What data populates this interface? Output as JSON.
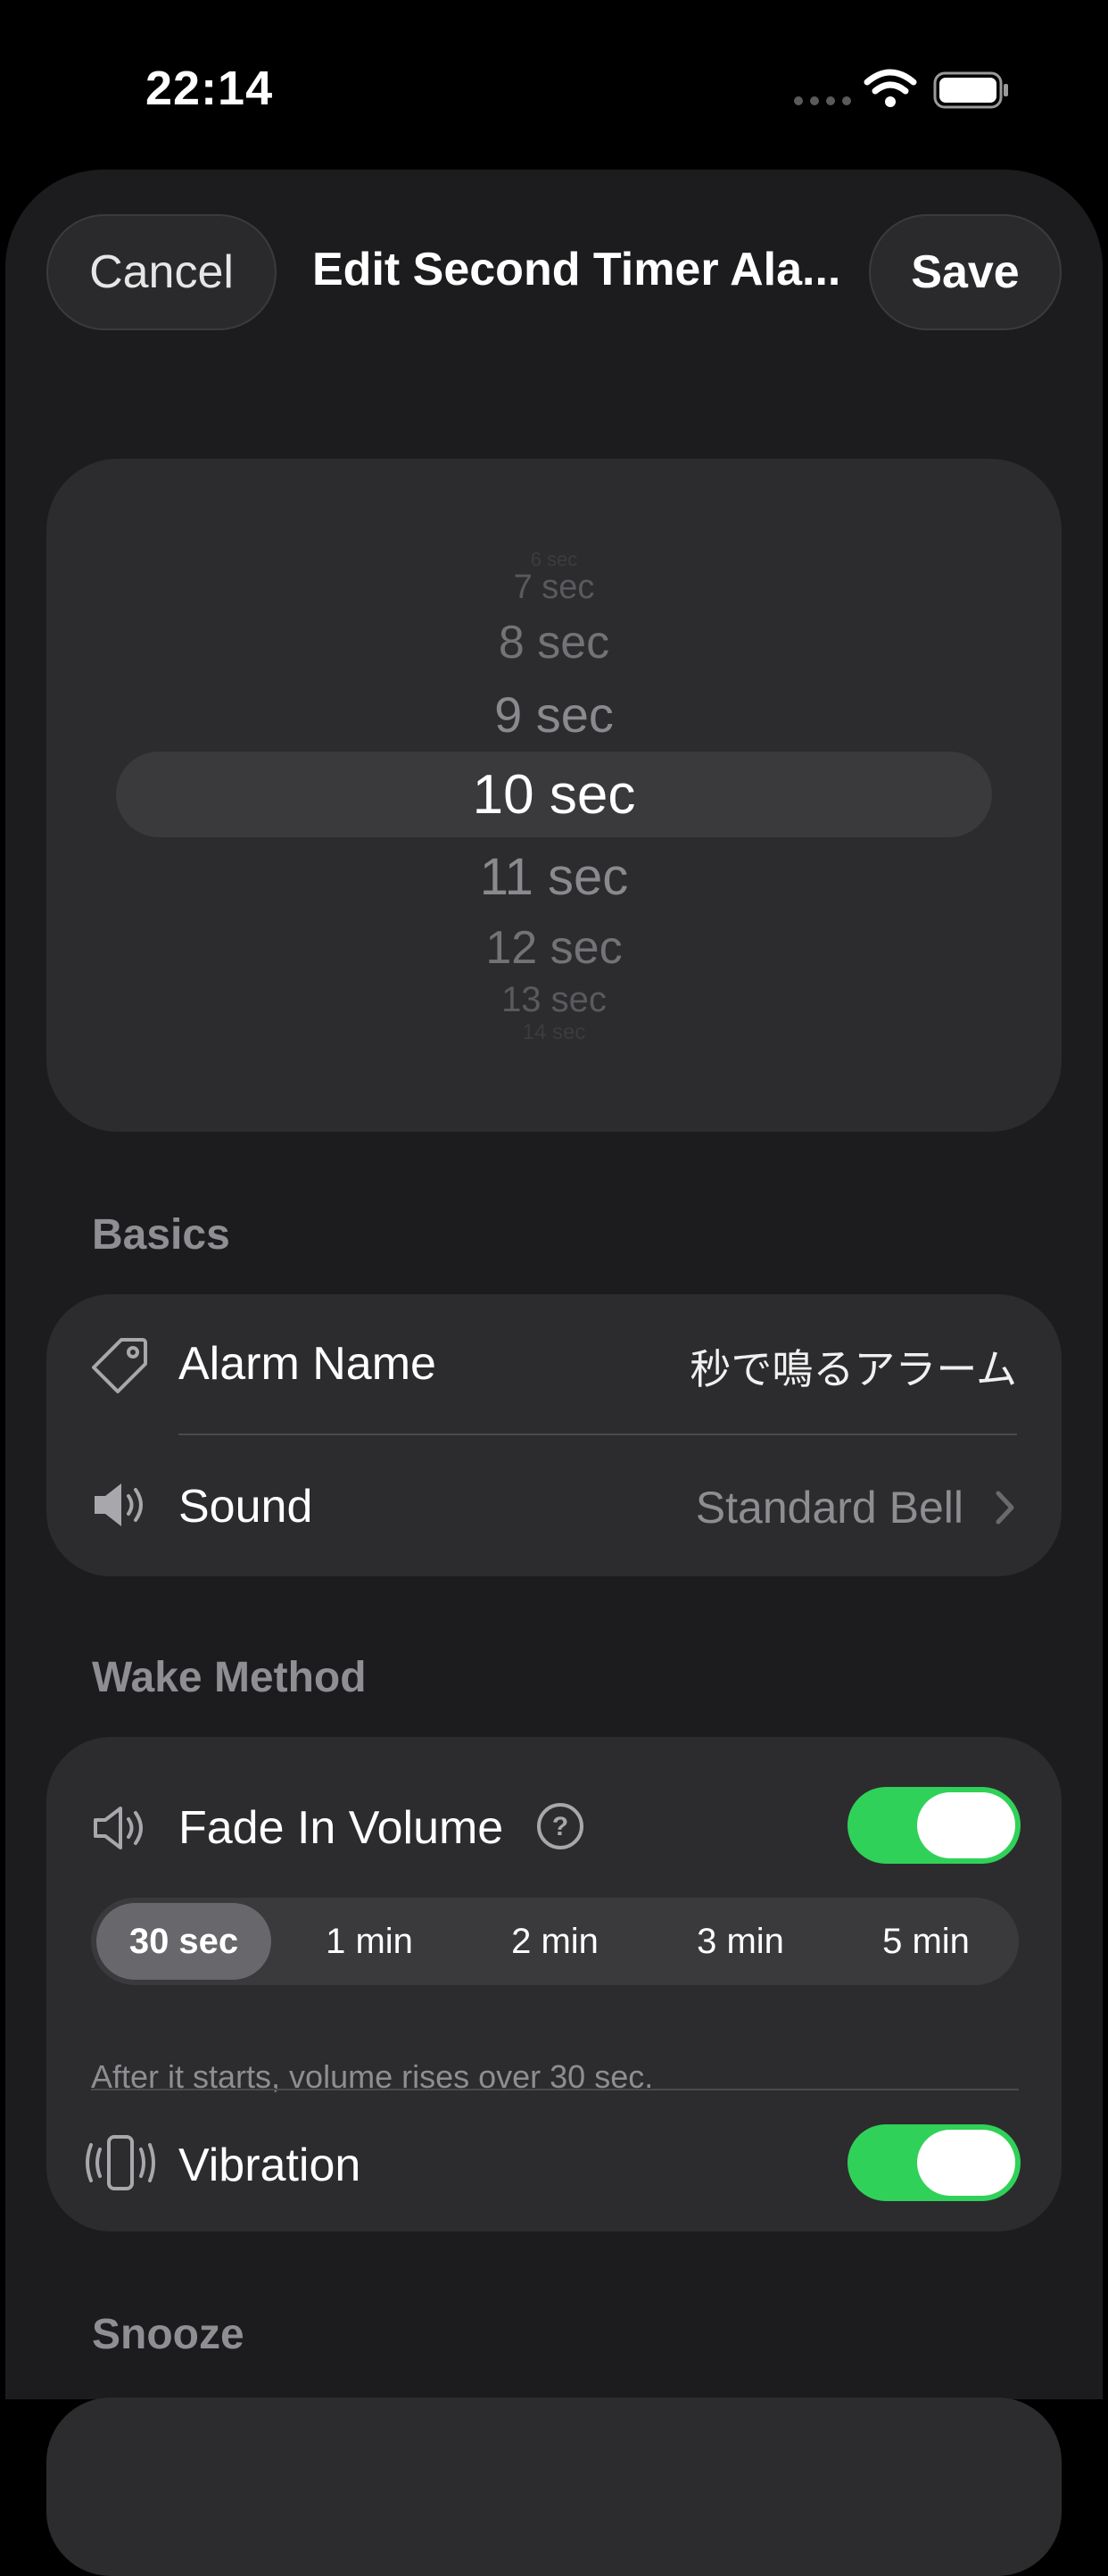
{
  "status": {
    "time": "22:14"
  },
  "nav": {
    "cancel": "Cancel",
    "title": "Edit Second Timer Ala...",
    "save": "Save"
  },
  "picker": {
    "rows": [
      "6 sec",
      "7 sec",
      "8 sec",
      "9 sec",
      "10 sec",
      "11 sec",
      "12 sec",
      "13 sec",
      "14 sec"
    ],
    "selected": "10 sec"
  },
  "basics": {
    "header": "Basics",
    "alarm_name_label": "Alarm Name",
    "alarm_name_value": "秒で鳴るアラーム",
    "sound_label": "Sound",
    "sound_value": "Standard Bell"
  },
  "wake": {
    "header": "Wake Method",
    "fade_label": "Fade In Volume",
    "fade_on": true,
    "durations": [
      "30 sec",
      "1 min",
      "2 min",
      "3 min",
      "5 min"
    ],
    "selected_duration": "30 sec",
    "helper": "After it starts, volume rises over 30 sec.",
    "vibration_label": "Vibration",
    "vibration_on": true
  },
  "snooze": {
    "header": "Snooze"
  },
  "colors": {
    "accent_green": "#30d158",
    "card": "#2c2c2e",
    "sheet": "#1c1c1e"
  },
  "icons": [
    "wifi-icon",
    "battery-icon",
    "tag-icon",
    "speaker-icon",
    "chevron-right-icon",
    "speaker-outline-icon",
    "help-circle-icon",
    "vibration-phone-icon"
  ]
}
